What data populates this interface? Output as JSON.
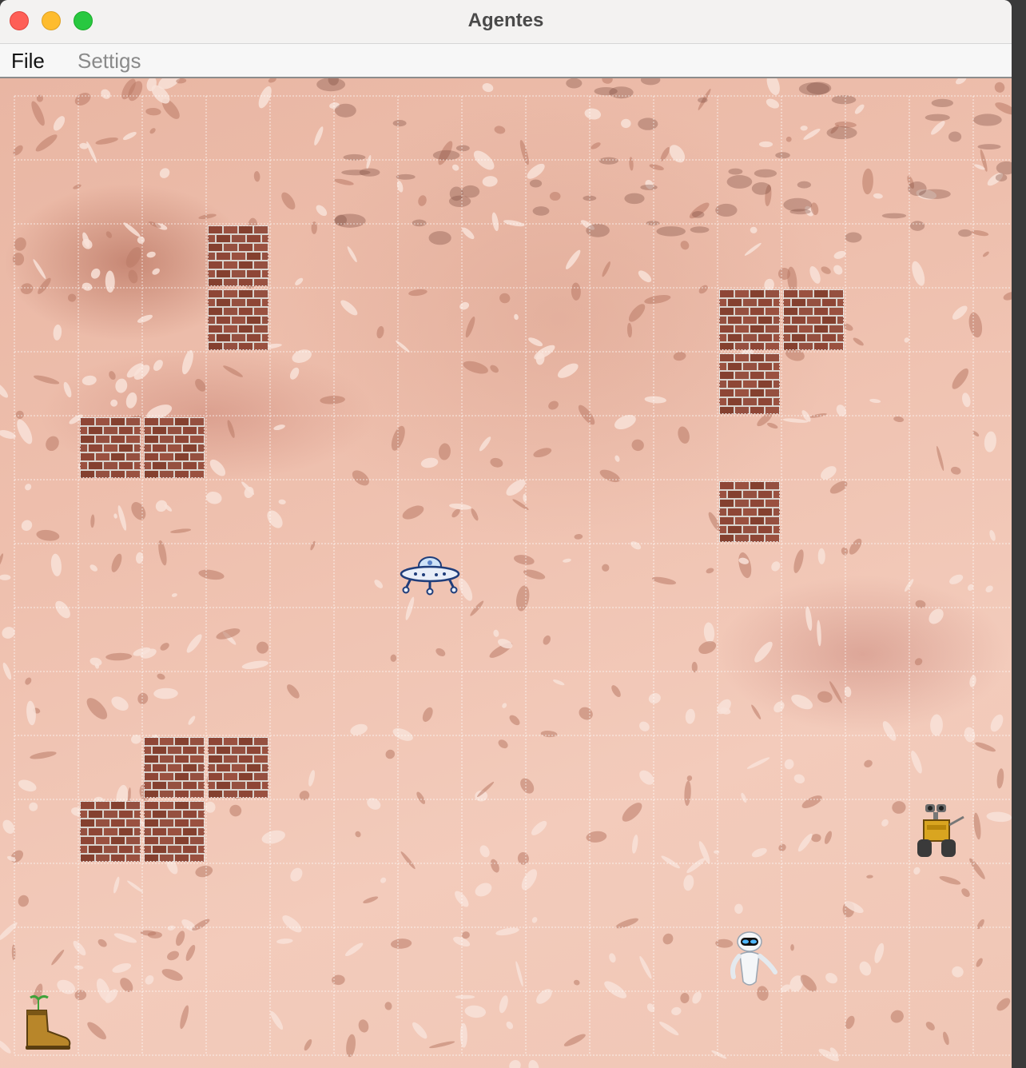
{
  "window": {
    "title": "Agentes",
    "colors": {
      "close": "#fe5f57",
      "minimize": "#febc2e",
      "zoom": "#28c840"
    }
  },
  "menu": {
    "items": [
      {
        "label": "File",
        "enabled": true
      },
      {
        "label": "Settigs",
        "enabled": false
      }
    ]
  },
  "board": {
    "columns": 16,
    "rows": 15,
    "background": "mars-terrain",
    "obstacles": [
      {
        "type": "brick-wall",
        "col": 3,
        "row": 2
      },
      {
        "type": "brick-wall",
        "col": 3,
        "row": 3
      },
      {
        "type": "brick-wall",
        "col": 11,
        "row": 3
      },
      {
        "type": "brick-wall",
        "col": 12,
        "row": 3
      },
      {
        "type": "brick-wall",
        "col": 11,
        "row": 4
      },
      {
        "type": "brick-wall",
        "col": 1,
        "row": 5
      },
      {
        "type": "brick-wall",
        "col": 2,
        "row": 5
      },
      {
        "type": "brick-wall",
        "col": 11,
        "row": 6
      },
      {
        "type": "brick-wall",
        "col": 2,
        "row": 10
      },
      {
        "type": "brick-wall",
        "col": 3,
        "row": 10
      },
      {
        "type": "brick-wall",
        "col": 1,
        "row": 11
      },
      {
        "type": "brick-wall",
        "col": 2,
        "row": 11
      }
    ],
    "agents": [
      {
        "name": "ufo-spaceship",
        "icon": "ufo-icon",
        "col": 6,
        "row": 7
      },
      {
        "name": "walle-robot",
        "icon": "walle-icon",
        "col": 14,
        "row": 11
      },
      {
        "name": "eve-robot",
        "icon": "eve-icon",
        "col": 11,
        "row": 13
      },
      {
        "name": "boot-with-plant",
        "icon": "boot-plant-icon",
        "col": 0,
        "row": 14
      }
    ]
  }
}
